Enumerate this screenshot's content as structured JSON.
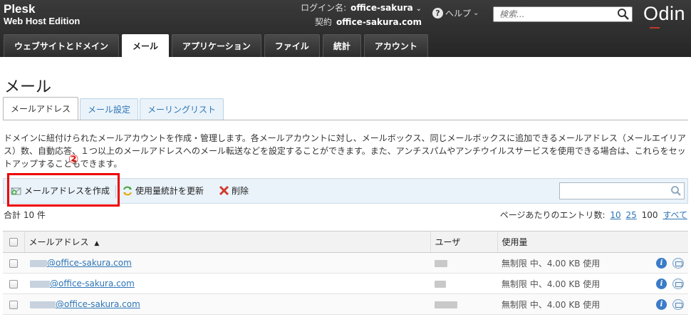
{
  "brand": {
    "name": "Plesk",
    "edition": "Web Host Edition"
  },
  "login": {
    "label": "ログイン名:",
    "user": "office-sakura",
    "contract_label": "契約",
    "contract": "office-sakura.com"
  },
  "help": {
    "label": "ヘルプ"
  },
  "top_search": {
    "placeholder": "検索..."
  },
  "logo": "Odin",
  "nav_tabs": [
    "ウェブサイトとドメイン",
    "メール",
    "アプリケーション",
    "ファイル",
    "統計",
    "アカウント"
  ],
  "page_title": "メール",
  "sub_tabs": [
    "メールアドレス",
    "メール設定",
    "メーリングリスト"
  ],
  "description": "ドメインに紐付けられたメールアカウントを作成・管理します。各メールアカウントに対し、メールボックス、同じメールボックスに追加できるメールアドレス（メールエイリアス）数、自動応答、１つ以上のメールアドレスへのメール転送などを設定することができます。また、アンチスパムやアンチウイルスサービスを使用できる場合は、これらをセットアップすることもできます。",
  "annotation": "②",
  "toolbar": {
    "create": "メールアドレスを作成",
    "refresh": "使用量統計を更新",
    "delete": "削除"
  },
  "total": "合計 10 件",
  "per_page": {
    "label": "ページあたりのエントリ数:",
    "opt10": "10",
    "opt25": "25",
    "current": "100",
    "all": "すべて"
  },
  "table": {
    "headers": {
      "email": "メールアドレス",
      "user": "ユーザ",
      "usage": "使用量"
    },
    "rows": [
      {
        "email_suffix": "@office-sakura.com",
        "usage": "無制限 中、4.00 KB 使用"
      },
      {
        "email_suffix": "@office-sakura.com",
        "usage": "無制限 中、4.00 KB 使用"
      },
      {
        "email_suffix": "@office-sakura.com",
        "usage": "無制限 中、4.00 KB 使用"
      }
    ]
  },
  "colors": {
    "header_bg": "#2d2d2d",
    "link": "#2d75b6",
    "highlight": "#e00000",
    "toolbar_bg": "#eaf3fa"
  }
}
